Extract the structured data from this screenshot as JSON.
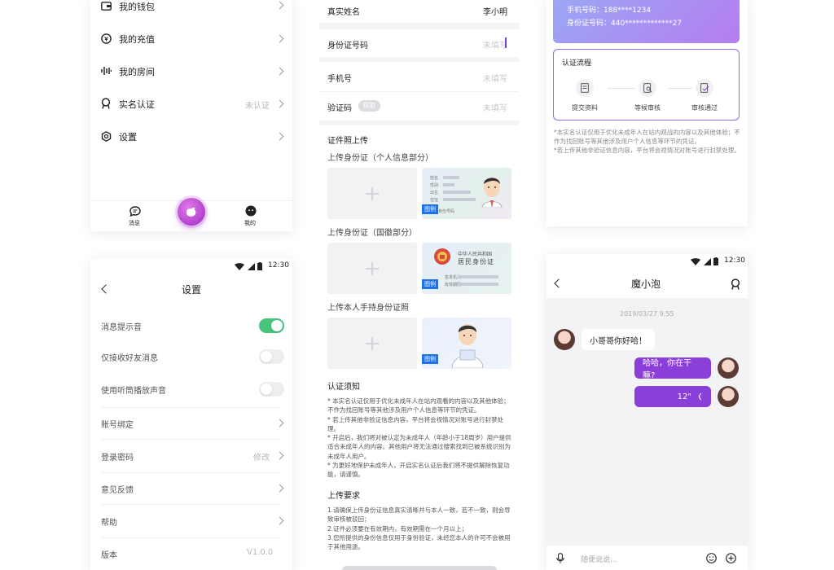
{
  "menu": {
    "items": [
      {
        "label": "我的钱包",
        "value": "",
        "icon": "wallet-icon"
      },
      {
        "label": "我的充值",
        "value": "",
        "icon": "recharge-icon"
      },
      {
        "label": "我的房间",
        "value": "",
        "icon": "room-icon"
      },
      {
        "label": "实名认证",
        "value": "未认证",
        "icon": "verify-icon"
      },
      {
        "label": "设置",
        "value": "",
        "icon": "settings-icon"
      }
    ],
    "tabs": {
      "messages": "消息",
      "mine": "我的"
    }
  },
  "settings": {
    "status_time": "12:30",
    "title": "设置",
    "toggles": [
      {
        "label": "消息提示音",
        "on": true
      },
      {
        "label": "仅接收好友消息",
        "on": false
      },
      {
        "label": "使用听筒播放声音",
        "on": false
      }
    ],
    "rows": [
      {
        "label": "账号绑定",
        "value": ""
      },
      {
        "label": "登录密码",
        "value": "修改"
      },
      {
        "label": "意见反馈",
        "value": ""
      },
      {
        "label": "帮助",
        "value": ""
      },
      {
        "label": "版本",
        "value": "V1.0.0"
      }
    ]
  },
  "form": {
    "name_label": "真实姓名",
    "name_value": "李小明",
    "id_label": "身份证号码",
    "id_placeholder": "未填写",
    "phone_label": "手机号",
    "phone_placeholder": "未填写",
    "code_label": "验证码",
    "code_button": "获取",
    "code_placeholder": "未填写",
    "upload_title": "证件照上传",
    "upload_front": "上传身份证（个人信息部分）",
    "upload_back": "上传身份证（国徽部分）",
    "upload_hand": "上传本人手持身份证照",
    "sample_tag": "图例",
    "card_front_fields": [
      "姓名",
      "性别",
      "出生",
      "住址",
      "公民身份号码"
    ],
    "card_back_title1": "中华人民共和国",
    "card_back_title2": "居民身份证",
    "card_back_fields": [
      "签发机关",
      "有效期限"
    ],
    "notice_title": "认证须知",
    "notice_text": "* 本实名认证仅用于优化未成年人在站内观看的内容以及其他体验；不作为找回账号等其他涉及用户个人信息等环节的凭证。\n* 若上传其他非验证信息内容，平台将会视情况对账号进行封禁处理。\n* 开启后，我们将对被认定为未成年人（年龄小于18周岁）用户提供适合未成年人的内容。其他用户将无法通过搜索找到已被系统识别为未成年人用户。\n* 为更好地保护未成年人，开启实名认证后我们将不提供解除恢复功能，请谨慎。",
    "req_title": "上传要求",
    "req_text": "1.请确保上传身份证信息真实清晰并与本人一致，若不一致，则会导致审核被驳回；\n2.证件必须要在有效期内，有效期需在一个月以上；\n3.您所提供的身份信息仅用于身份验证，未经您本人的许可不会被用于其他用途。"
  },
  "status_card": {
    "phone": "手机号码：188****1234",
    "idno": "身份证号码：440*************27",
    "flow_title": "认证流程",
    "steps": [
      "提交资料",
      "等候审核",
      "审核通过"
    ],
    "note": "*本实名认证仅用于优化未成年人在站内观战的内容以及其他体验；不作为找回账号等其他涉及用户个人信息等环节的凭证。\n*若上传其他非验证信息内容，平台将会视情况对账号进行封禁处理。"
  },
  "chat": {
    "status_time": "12:30",
    "title": "魔小泡",
    "timestamp": "2019/03/27 9:55",
    "messages": [
      {
        "from": "them",
        "text": "小哥哥你好哈！"
      },
      {
        "from": "me",
        "text": "哈哈，你在干嘛?"
      },
      {
        "from": "me",
        "text": "12\""
      }
    ],
    "input_placeholder": "随便说说..."
  },
  "colors": {
    "accent": "#7a3ed8",
    "toggle_on": "#45c47c",
    "sample_tag": "#1e73e8"
  }
}
